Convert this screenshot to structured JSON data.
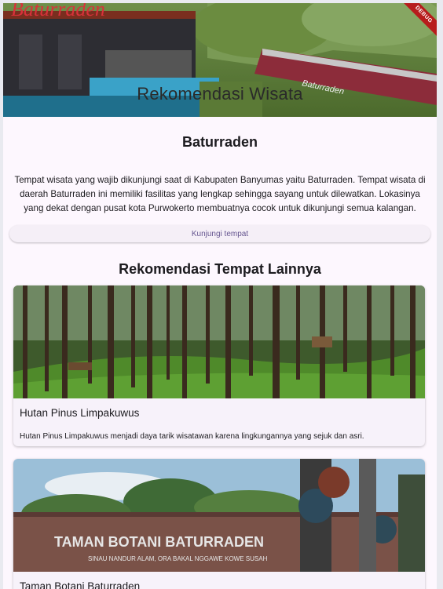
{
  "app_bar": {
    "title": "Rekomendasi Wisata",
    "debug_banner": "DEBUG"
  },
  "featured": {
    "name": "Baturraden",
    "description": "Tempat wisata yang wajib dikunjungi saat di Kabupaten Banyumas yaitu Baturraden. Tempat wisata di daerah Baturraden ini memiliki fasilitas yang lengkap sehingga sayang untuk dilewatkan. Lokasinya yang dekat dengan pusat kota Purwokerto membuatnya cocok untuk dikunjungi semua kalangan.",
    "visit_button": "Kunjungi tempat"
  },
  "other": {
    "heading": "Rekomendasi Tempat Lainnya",
    "places": [
      {
        "name": "Hutan Pinus Limpakuwus",
        "description": "Hutan Pinus Limpakuwus menjadi daya tarik wisatawan karena lingkungannya yang sejuk dan asri."
      },
      {
        "name": "Taman Botani Baturraden",
        "sign_line1": "TAMAN BOTANI BATURRADEN",
        "sign_line2": "SINAU NANDUR ALAM, ORA BAKAL NGGAWE KOWE SUSAH"
      }
    ]
  },
  "colors": {
    "background": "#fdf7fe",
    "button_text": "#65558f",
    "card": "#f7f2fa",
    "debug": "#b71c1c"
  }
}
